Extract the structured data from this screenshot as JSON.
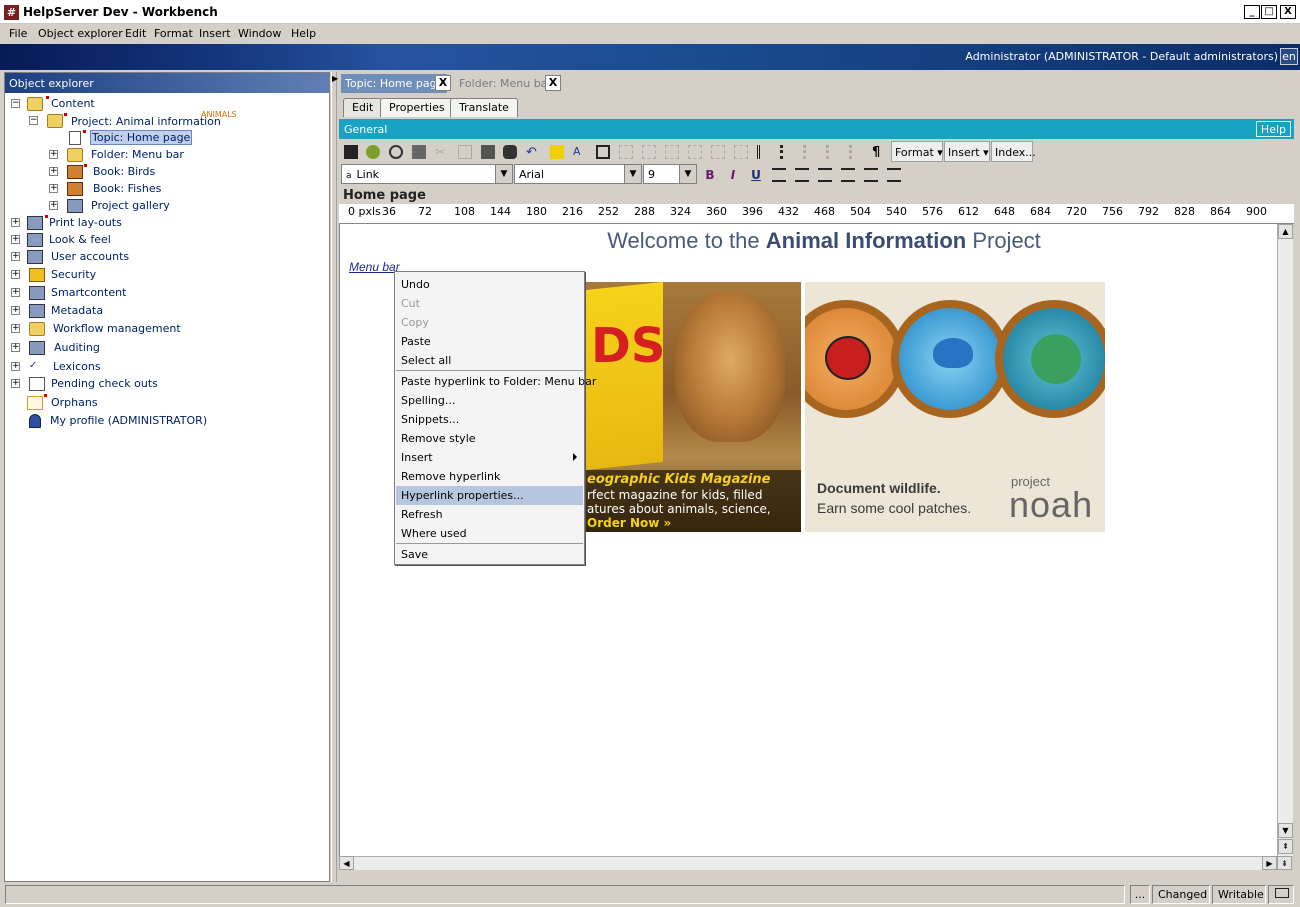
{
  "window": {
    "title": "HelpServer Dev - Workbench",
    "app_icon": "#",
    "controls": {
      "minimize": "_",
      "maximize": "□",
      "close": "X"
    }
  },
  "menu": [
    "File",
    "Object explorer",
    "Edit",
    "Format",
    "Insert",
    "Window",
    "Help"
  ],
  "banner": {
    "user": "Administrator (ADMINISTRATOR - Default administrators)",
    "lang": "en"
  },
  "explorer": {
    "title": "Object explorer",
    "tree": [
      {
        "label": "Content",
        "exp": "−",
        "icon": "folder-open-icon"
      },
      {
        "label": "Project: Animal information",
        "badge": "ANIMALS",
        "exp": "−",
        "icon": "project-folder-icon"
      },
      {
        "label": "Topic: Home page",
        "icon": "topic-icon"
      },
      {
        "label": "Folder: Menu bar",
        "exp": "+",
        "icon": "folder-icon"
      },
      {
        "label": "Book: Birds",
        "exp": "+",
        "icon": "book-icon"
      },
      {
        "label": "Book: Fishes",
        "exp": "+",
        "icon": "book-icon"
      },
      {
        "label": "Project gallery",
        "exp": "+",
        "icon": "gallery-icon"
      },
      {
        "label": "Print lay-outs",
        "exp": "+",
        "icon": "printer-icon"
      },
      {
        "label": "Look & feel",
        "exp": "+",
        "icon": "monitor-icon"
      },
      {
        "label": "User accounts",
        "exp": "+",
        "icon": "users-icon"
      },
      {
        "label": "Security",
        "exp": "+",
        "icon": "lock-icon"
      },
      {
        "label": "Smartcontent",
        "exp": "+",
        "icon": "smartcontent-icon"
      },
      {
        "label": "Metadata",
        "exp": "+",
        "icon": "metadata-icon"
      },
      {
        "label": "Workflow management",
        "exp": "+",
        "icon": "workflow-icon"
      },
      {
        "label": "Auditing",
        "exp": "+",
        "icon": "auditing-icon"
      },
      {
        "label": "Lexicons",
        "exp": "+",
        "icon": "lexicon-icon"
      },
      {
        "label": "Pending check outs",
        "exp": "+",
        "icon": "checkout-icon"
      },
      {
        "label": "Orphans",
        "icon": "orphans-icon"
      },
      {
        "label": "My profile (ADMINISTRATOR)",
        "icon": "profile-icon"
      }
    ]
  },
  "doc_tabs": [
    {
      "label": "Topic: Home page",
      "close": "X"
    },
    {
      "label": "Folder: Menu bar",
      "close": "X"
    }
  ],
  "sub_tabs": [
    "Edit",
    "Properties",
    "Translate"
  ],
  "section": {
    "title": "General",
    "help": "Help"
  },
  "toolbar": {
    "format": "Format",
    "insert": "Insert",
    "index": "Index..."
  },
  "format_bar": {
    "style": "Link",
    "font": "Arial",
    "size": "9",
    "bold": "B",
    "italic": "I",
    "underline": "U"
  },
  "page": {
    "title": "Home page",
    "ruler": [
      "0 pxls",
      "36",
      "72",
      "108",
      "144",
      "180",
      "216",
      "252",
      "288",
      "324",
      "360",
      "396",
      "432",
      "468",
      "504",
      "540",
      "576",
      "612",
      "648",
      "684",
      "720",
      "756",
      "792",
      "828",
      "864",
      "900"
    ],
    "heading": {
      "prefix": "Welcome to the ",
      "bold": "Animal Information",
      "suffix": " Project"
    },
    "link": "Menu bar",
    "magazine": {
      "cover_text": "DS",
      "caption1": "eographic Kids Magazine",
      "caption2": "rfect magazine for kids, filled",
      "caption3": "atures about animals, science,",
      "caption4": "Order Now »"
    },
    "noah": {
      "line1": "Document wildlife.",
      "line2": "Earn some cool patches.",
      "logo_small": "project",
      "logo_big": "noah"
    }
  },
  "context_menu": [
    {
      "label": "Undo"
    },
    {
      "label": "Cut",
      "disabled": true
    },
    {
      "label": "Copy",
      "disabled": true
    },
    {
      "label": "Paste"
    },
    {
      "label": "Select all"
    },
    {
      "label": "Paste hyperlink to Folder: Menu bar"
    },
    {
      "label": "Spelling..."
    },
    {
      "label": "Snippets..."
    },
    {
      "label": "Remove style"
    },
    {
      "label": "Insert",
      "submenu": true
    },
    {
      "label": "Remove hyperlink"
    },
    {
      "label": "Hyperlink properties...",
      "highlighted": true
    },
    {
      "label": "Refresh"
    },
    {
      "label": "Where used"
    },
    {
      "label": "Save"
    }
  ],
  "status": {
    "ellipsis": "...",
    "changed": "Changed",
    "writable": "Writable"
  }
}
